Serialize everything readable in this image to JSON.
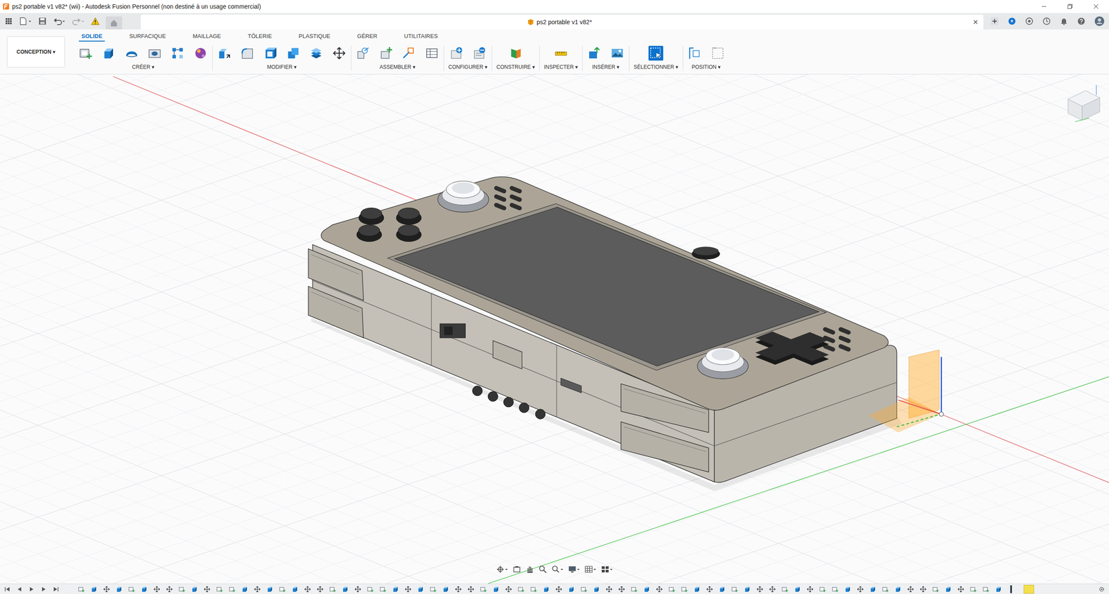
{
  "window": {
    "title": "ps2 portable v1 v82* (wii) - Autodesk Fusion Personnel (non destiné à un usage commercial)"
  },
  "document_tab": {
    "label": "ps2 portable v1 v82*"
  },
  "workspace": {
    "label": "CONCEPTION ▾"
  },
  "tabs": [
    {
      "label": "SOLIDE",
      "selected": true
    },
    {
      "label": "SURFACIQUE",
      "selected": false
    },
    {
      "label": "MAILLAGE",
      "selected": false
    },
    {
      "label": "TÔLERIE",
      "selected": false
    },
    {
      "label": "PLASTIQUE",
      "selected": false
    },
    {
      "label": "GÉRER",
      "selected": false
    },
    {
      "label": "UTILITAIRES",
      "selected": false
    }
  ],
  "groups": [
    {
      "label": "CRÉER ▾",
      "active": false
    },
    {
      "label": "MODIFIER ▾",
      "active": false
    },
    {
      "label": "ASSEMBLER ▾",
      "active": false
    },
    {
      "label": "CONFIGURER ▾",
      "active": false
    },
    {
      "label": "CONSTRUIRE ▾",
      "active": false
    },
    {
      "label": "INSPECTER ▾",
      "active": false
    },
    {
      "label": "INSÉRER ▾",
      "active": false
    },
    {
      "label": "SÉLECTIONNER ▾",
      "active": true
    },
    {
      "label": "POSITION ▾",
      "active": false
    }
  ]
}
